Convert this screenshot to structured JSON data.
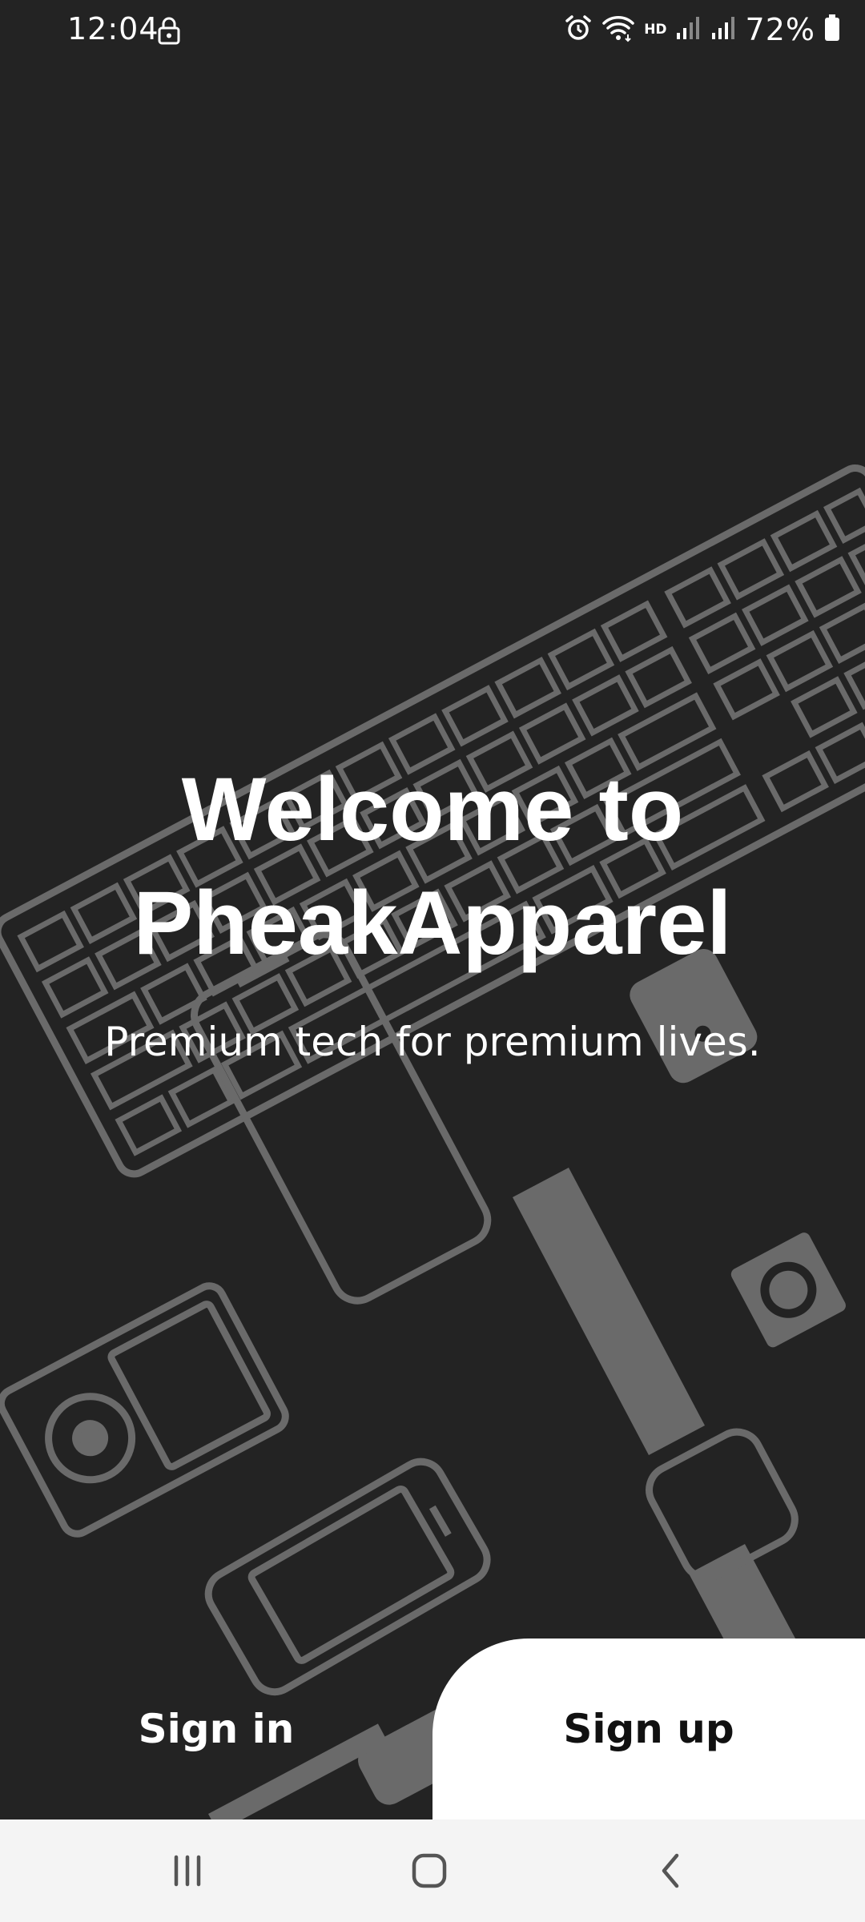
{
  "status_bar": {
    "time": "12:04",
    "battery_percent": "72%",
    "network_label": "HD"
  },
  "welcome": {
    "title_line1": "Welcome to",
    "title_line2": "PheakApparel",
    "tagline": "Premium tech for premium lives."
  },
  "auth": {
    "sign_in_label": "Sign in",
    "sign_up_label": "Sign up"
  },
  "icons": {
    "lock": "lock-icon",
    "alarm": "alarm-icon",
    "wifi": "wifi-icon",
    "signal": "signal-icon",
    "battery": "battery-icon",
    "recents": "recent-apps-icon",
    "home": "home-icon",
    "back": "back-icon"
  },
  "colors": {
    "background": "#232323",
    "illustration": "#6a6a6a",
    "primary_text": "#ffffff",
    "sign_up_bg": "#ffffff",
    "nav_bar": "#f4f4f4"
  }
}
